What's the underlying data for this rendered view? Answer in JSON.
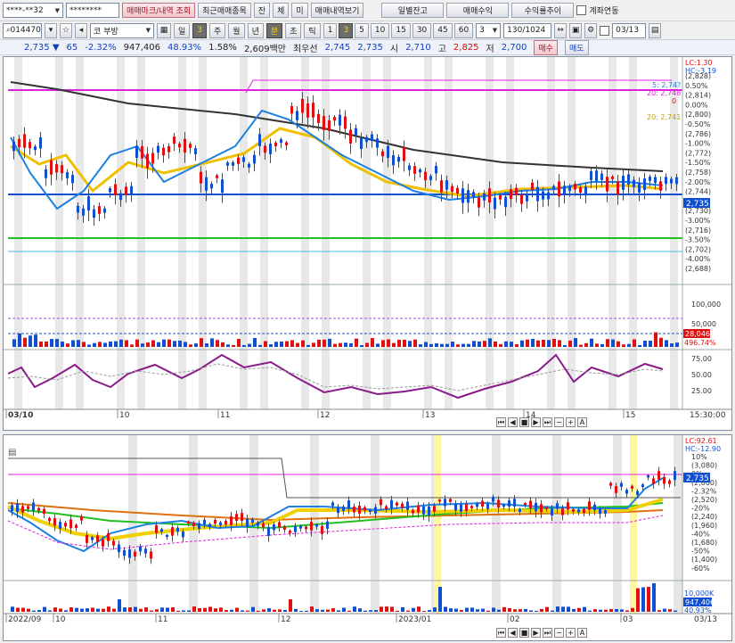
{
  "top": {
    "account_value": "****-**32",
    "password_value": "********",
    "tab_orders": "매매마크/내역 조회",
    "tab_recent": "최근매매종목",
    "short_jan": "잔",
    "short_che": "체",
    "short_mi": "미",
    "tab_trades": "매매내역보기",
    "btn_balance": "일별잔고",
    "btn_profit": "매매수익",
    "btn_trend": "수익률추이",
    "account_link_label": "계좌연동"
  },
  "toolbar": {
    "code": "014470",
    "name": "부방",
    "prefix": "코",
    "period_il": "일",
    "period_num": "3",
    "period_ju": "주",
    "period_wol": "월",
    "period_nyeon": "년",
    "period_bun": "분",
    "period_cho": "초",
    "period_tik": "틱",
    "intervals": [
      "1",
      "3",
      "5",
      "10",
      "15",
      "30",
      "45",
      "60"
    ],
    "interval_sel": "3",
    "count": "130/1024",
    "date": "03/13"
  },
  "quote": {
    "price": "2,735",
    "arrow": "▼",
    "change": "65",
    "pct": "-2.32%",
    "volume": "947,406",
    "vol_ratio": "48.93%",
    "turnover": "1.58%",
    "amount": "2,609백만",
    "best_label": "최우선",
    "ask": "2,745",
    "bid": "2,735",
    "open_label": "시",
    "open": "2,710",
    "high_label": "고",
    "high": "2,825",
    "low_label": "저",
    "low": "2,700",
    "buy_btn": "매수",
    "sell_btn": "매도"
  },
  "chart1": {
    "right_axis_top": [
      "LC:1.30",
      "HC:-3.19"
    ],
    "right_axis": [
      "(2,828)",
      "0.50%",
      "(2,814)",
      "0.00%",
      "(2,800)",
      "-0.50%",
      "(2,786)",
      "-1.00%",
      "(2,772)",
      "-1.50%",
      "(2,758)",
      "-2.00%",
      "(2,744)",
      "-2.50%",
      "(2,730)",
      "-3.00%",
      "(2,716)",
      "-3.50%",
      "(2,702)",
      "-4.00%",
      "(2,688)"
    ],
    "current_price_tag": "2,735",
    "ma_labels": [
      "5: 2,74?",
      "20: 2,748",
      "0",
      "20: 2,741"
    ],
    "vol_axis": [
      "100,000",
      "50,000"
    ],
    "vol_tag": "28,046",
    "vol_pct": "496.74%",
    "osc_axis": [
      "75.00",
      "50.00",
      "25.00"
    ],
    "time_labels": [
      "03/10",
      "10",
      "11",
      "12",
      "13",
      "14",
      "15"
    ],
    "time_right": "15:30:00"
  },
  "chart2": {
    "right_axis_top": [
      "LC:92.61",
      "HC:-12.90"
    ],
    "right_axis": [
      "10%",
      "(3,080)",
      "0%",
      "(2,800)",
      "-2.32%",
      "(2,520)",
      "-20%",
      "(2,240)",
      "(1,960)",
      "-40%",
      "(1,680)",
      "-50%",
      "(1,400)",
      "-60%"
    ],
    "current_price_tag": "2,735",
    "vol_axis": [
      "10,000K"
    ],
    "vol_tag": "947,406",
    "vol_pct": "40.93%",
    "time_labels": [
      "2022/09",
      "10",
      "11",
      "12",
      "2023/01",
      "02",
      "03"
    ],
    "time_right": "03/13"
  },
  "colors": {
    "up": "#e01010",
    "down": "#1050d0",
    "ma_black": "#333333",
    "ma_magenta": "#e020e0",
    "ma_yellow": "#f0c000",
    "ma_green": "#20c020"
  }
}
